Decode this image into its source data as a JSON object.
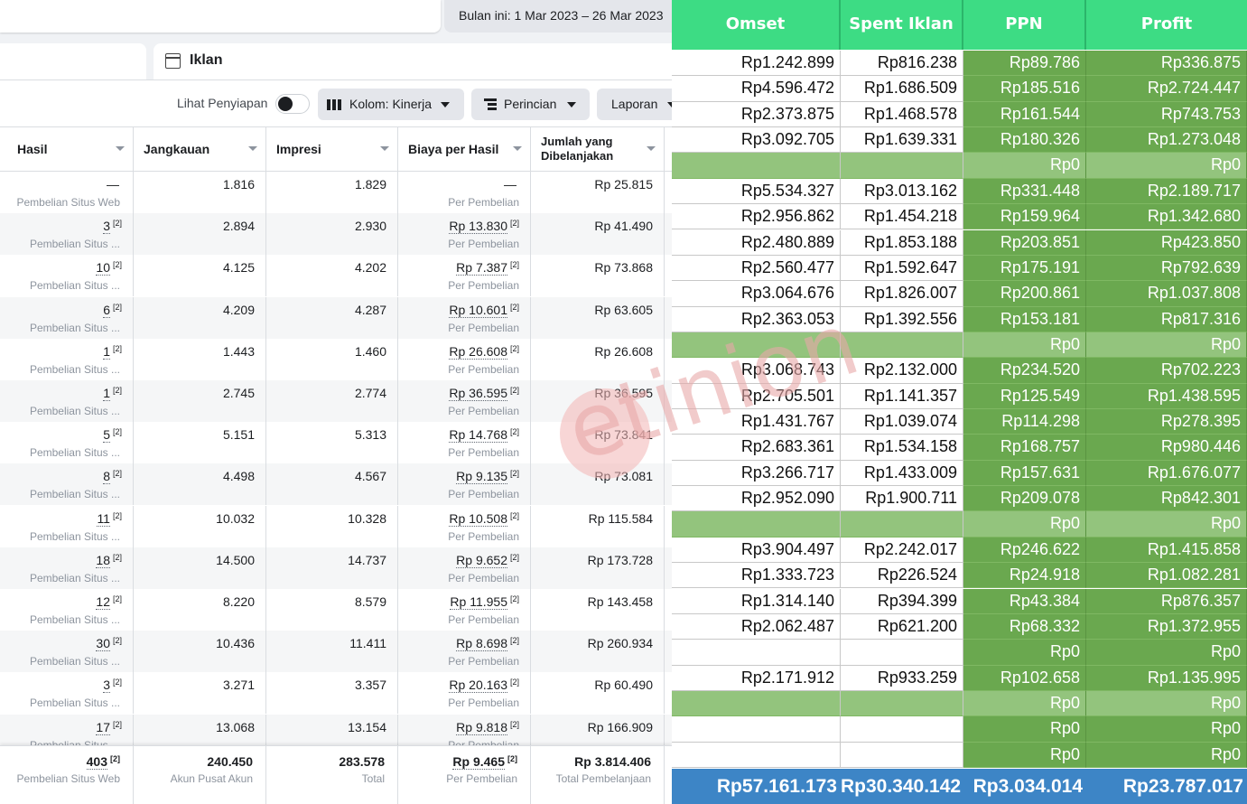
{
  "left": {
    "date_range": "Bulan ini: 1 Mar 2023 – 26 Mar 2023",
    "tab_label": "Iklan",
    "toolbar": {
      "preview_label": "Lihat Penyiapan",
      "columns_label": "Kolom: Kinerja",
      "breakdown_label": "Perincian",
      "report_label": "Laporan"
    },
    "headers": [
      "Hasil",
      "Jangkauan",
      "Impresi",
      "Biaya per Hasil",
      "Jumlah yang Dibelanjakan"
    ],
    "rows": [
      {
        "hasil": "—",
        "hasil_fn": "",
        "hasil_sub": "Pembelian Situs Web",
        "jangkauan": "1.816",
        "impresi": "1.829",
        "biaya": "—",
        "biaya_fn": "",
        "biaya_sub": "Per Pembelian",
        "jumlah": "Rp 25.815"
      },
      {
        "hasil": "3",
        "hasil_fn": "[2]",
        "hasil_sub": "Pembelian Situs ...",
        "jangkauan": "2.894",
        "impresi": "2.930",
        "biaya": "Rp 13.830",
        "biaya_fn": "[2]",
        "biaya_sub": "Per Pembelian",
        "jumlah": "Rp 41.490"
      },
      {
        "hasil": "10",
        "hasil_fn": "[2]",
        "hasil_sub": "Pembelian Situs ...",
        "jangkauan": "4.125",
        "impresi": "4.202",
        "biaya": "Rp 7.387",
        "biaya_fn": "[2]",
        "biaya_sub": "Per Pembelian",
        "jumlah": "Rp 73.868"
      },
      {
        "hasil": "6",
        "hasil_fn": "[2]",
        "hasil_sub": "Pembelian Situs ...",
        "jangkauan": "4.209",
        "impresi": "4.287",
        "biaya": "Rp 10.601",
        "biaya_fn": "[2]",
        "biaya_sub": "Per Pembelian",
        "jumlah": "Rp 63.605"
      },
      {
        "hasil": "1",
        "hasil_fn": "[2]",
        "hasil_sub": "Pembelian Situs ...",
        "jangkauan": "1.443",
        "impresi": "1.460",
        "biaya": "Rp 26.608",
        "biaya_fn": "[2]",
        "biaya_sub": "Per Pembelian",
        "jumlah": "Rp 26.608"
      },
      {
        "hasil": "1",
        "hasil_fn": "[2]",
        "hasil_sub": "Pembelian Situs ...",
        "jangkauan": "2.745",
        "impresi": "2.774",
        "biaya": "Rp 36.595",
        "biaya_fn": "[2]",
        "biaya_sub": "Per Pembelian",
        "jumlah": "Rp 36.595"
      },
      {
        "hasil": "5",
        "hasil_fn": "[2]",
        "hasil_sub": "Pembelian Situs ...",
        "jangkauan": "5.151",
        "impresi": "5.313",
        "biaya": "Rp 14.768",
        "biaya_fn": "[2]",
        "biaya_sub": "Per Pembelian",
        "jumlah": "Rp 73.841"
      },
      {
        "hasil": "8",
        "hasil_fn": "[2]",
        "hasil_sub": "Pembelian Situs ...",
        "jangkauan": "4.498",
        "impresi": "4.567",
        "biaya": "Rp 9.135",
        "biaya_fn": "[2]",
        "biaya_sub": "Per Pembelian",
        "jumlah": "Rp 73.081"
      },
      {
        "hasil": "11",
        "hasil_fn": "[2]",
        "hasil_sub": "Pembelian Situs ...",
        "jangkauan": "10.032",
        "impresi": "10.328",
        "biaya": "Rp 10.508",
        "biaya_fn": "[2]",
        "biaya_sub": "Per Pembelian",
        "jumlah": "Rp 115.584"
      },
      {
        "hasil": "18",
        "hasil_fn": "[2]",
        "hasil_sub": "Pembelian Situs ...",
        "jangkauan": "14.500",
        "impresi": "14.737",
        "biaya": "Rp 9.652",
        "biaya_fn": "[2]",
        "biaya_sub": "Per Pembelian",
        "jumlah": "Rp 173.728"
      },
      {
        "hasil": "12",
        "hasil_fn": "[2]",
        "hasil_sub": "Pembelian Situs ...",
        "jangkauan": "8.220",
        "impresi": "8.579",
        "biaya": "Rp 11.955",
        "biaya_fn": "[2]",
        "biaya_sub": "Per Pembelian",
        "jumlah": "Rp 143.458"
      },
      {
        "hasil": "30",
        "hasil_fn": "[2]",
        "hasil_sub": "Pembelian Situs ...",
        "jangkauan": "10.436",
        "impresi": "11.411",
        "biaya": "Rp 8.698",
        "biaya_fn": "[2]",
        "biaya_sub": "Per Pembelian",
        "jumlah": "Rp 260.934"
      },
      {
        "hasil": "3",
        "hasil_fn": "[2]",
        "hasil_sub": "Pembelian Situs ...",
        "jangkauan": "3.271",
        "impresi": "3.357",
        "biaya": "Rp 20.163",
        "biaya_fn": "[2]",
        "biaya_sub": "Per Pembelian",
        "jumlah": "Rp 60.490"
      },
      {
        "hasil": "17",
        "hasil_fn": "[2]",
        "hasil_sub": "Pembelian Situs ...",
        "jangkauan": "13.068",
        "impresi": "13.154",
        "biaya": "Rp 9.818",
        "biaya_fn": "[2]",
        "biaya_sub": "Per Pembelian",
        "jumlah": "Rp 166.909"
      }
    ],
    "totals": {
      "hasil": "403",
      "hasil_fn": "[2]",
      "hasil_sub": "Pembelian Situs Web",
      "jangkauan": "240.450",
      "jangkauan_sub": "Akun Pusat Akun",
      "impresi": "283.578",
      "impresi_sub": "Total",
      "biaya": "Rp 9.465",
      "biaya_fn": "[2]",
      "biaya_sub": "Per Pembelian",
      "jumlah": "Rp 3.814.406",
      "jumlah_sub": "Total Pembelanjaan"
    }
  },
  "sheet": {
    "headers": [
      "Omset",
      "Spent Iklan",
      "PPN",
      "Profit"
    ],
    "rows": [
      {
        "sep": false,
        "cells": [
          "Rp1.242.899",
          "Rp816.238",
          "Rp89.786",
          "Rp336.875"
        ]
      },
      {
        "sep": false,
        "cells": [
          "Rp4.596.472",
          "Rp1.686.509",
          "Rp185.516",
          "Rp2.724.447"
        ]
      },
      {
        "sep": false,
        "cells": [
          "Rp2.373.875",
          "Rp1.468.578",
          "Rp161.544",
          "Rp743.753"
        ]
      },
      {
        "sep": false,
        "cells": [
          "Rp3.092.705",
          "Rp1.639.331",
          "Rp180.326",
          "Rp1.273.048"
        ]
      },
      {
        "sep": true,
        "cells": [
          "",
          "",
          "Rp0",
          "Rp0"
        ]
      },
      {
        "sep": false,
        "cells": [
          "Rp5.534.327",
          "Rp3.013.162",
          "Rp331.448",
          "Rp2.189.717"
        ]
      },
      {
        "sep": false,
        "cells": [
          "Rp2.956.862",
          "Rp1.454.218",
          "Rp159.964",
          "Rp1.342.680"
        ]
      },
      {
        "sep": false,
        "cells": [
          "Rp2.480.889",
          "Rp1.853.188",
          "Rp203.851",
          "Rp423.850"
        ]
      },
      {
        "sep": false,
        "cells": [
          "Rp2.560.477",
          "Rp1.592.647",
          "Rp175.191",
          "Rp792.639"
        ]
      },
      {
        "sep": false,
        "cells": [
          "Rp3.064.676",
          "Rp1.826.007",
          "Rp200.861",
          "Rp1.037.808"
        ]
      },
      {
        "sep": false,
        "cells": [
          "Rp2.363.053",
          "Rp1.392.556",
          "Rp153.181",
          "Rp817.316"
        ]
      },
      {
        "sep": true,
        "cells": [
          "",
          "",
          "Rp0",
          "Rp0"
        ]
      },
      {
        "sep": false,
        "cells": [
          "Rp3.068.743",
          "Rp2.132.000",
          "Rp234.520",
          "Rp702.223"
        ]
      },
      {
        "sep": false,
        "cells": [
          "Rp2.705.501",
          "Rp1.141.357",
          "Rp125.549",
          "Rp1.438.595"
        ]
      },
      {
        "sep": false,
        "cells": [
          "Rp1.431.767",
          "Rp1.039.074",
          "Rp114.298",
          "Rp278.395"
        ]
      },
      {
        "sep": false,
        "cells": [
          "Rp2.683.361",
          "Rp1.534.158",
          "Rp168.757",
          "Rp980.446"
        ]
      },
      {
        "sep": false,
        "cells": [
          "Rp3.266.717",
          "Rp1.433.009",
          "Rp157.631",
          "Rp1.676.077"
        ]
      },
      {
        "sep": false,
        "cells": [
          "Rp2.952.090",
          "Rp1.900.711",
          "Rp209.078",
          "Rp842.301"
        ]
      },
      {
        "sep": true,
        "cells": [
          "",
          "",
          "Rp0",
          "Rp0"
        ]
      },
      {
        "sep": false,
        "cells": [
          "Rp3.904.497",
          "Rp2.242.017",
          "Rp246.622",
          "Rp1.415.858"
        ]
      },
      {
        "sep": false,
        "cells": [
          "Rp1.333.723",
          "Rp226.524",
          "Rp24.918",
          "Rp1.082.281"
        ]
      },
      {
        "sep": false,
        "cells": [
          "Rp1.314.140",
          "Rp394.399",
          "Rp43.384",
          "Rp876.357"
        ]
      },
      {
        "sep": false,
        "cells": [
          "Rp2.062.487",
          "Rp621.200",
          "Rp68.332",
          "Rp1.372.955"
        ]
      },
      {
        "sep": false,
        "cells": [
          "",
          "",
          "Rp0",
          "Rp0"
        ]
      },
      {
        "sep": false,
        "cells": [
          "Rp2.171.912",
          "Rp933.259",
          "Rp102.658",
          "Rp1.135.995"
        ]
      },
      {
        "sep": true,
        "cells": [
          "",
          "",
          "Rp0",
          "Rp0"
        ]
      },
      {
        "sep": false,
        "cells": [
          "",
          "",
          "Rp0",
          "Rp0"
        ]
      },
      {
        "sep": false,
        "cells": [
          "",
          "",
          "Rp0",
          "Rp0"
        ]
      }
    ],
    "totals": [
      "Rp57.161.173",
      "Rp30.340.142",
      "Rp3.034.014",
      "Rp23.787.017"
    ]
  },
  "watermark_text": "etinion",
  "colors": {
    "sheet_header": "#3ddc84",
    "sheet_green": "#6aa84f",
    "sheet_light_green": "#93c47d",
    "sheet_total": "#3d85c6"
  }
}
